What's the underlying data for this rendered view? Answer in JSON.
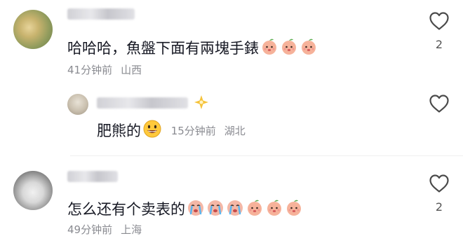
{
  "comments": [
    {
      "text": "哈哈哈，魚盤下面有兩塊手錶",
      "emojis": [
        "peach-face-icon",
        "peach-face-icon",
        "peach-face-icon"
      ],
      "time": "41分钟前",
      "location": "山西",
      "likes": "2"
    },
    {
      "text": "肥熊的",
      "emojis": [
        "grin-face-icon"
      ],
      "time": "15分钟前",
      "location": "湖北",
      "likes": ""
    },
    {
      "text": "怎么还有个卖表的",
      "emojis": [
        "crying-face-icon",
        "crying-face-icon",
        "crying-face-icon",
        "peach-face-icon",
        "peach-face-icon",
        "peach-face-icon"
      ],
      "time": "49分钟前",
      "location": "上海",
      "likes": "2"
    }
  ],
  "colors": {
    "text": "#161823",
    "meta": "#8a8b91",
    "heart": "#4a4a4a"
  }
}
